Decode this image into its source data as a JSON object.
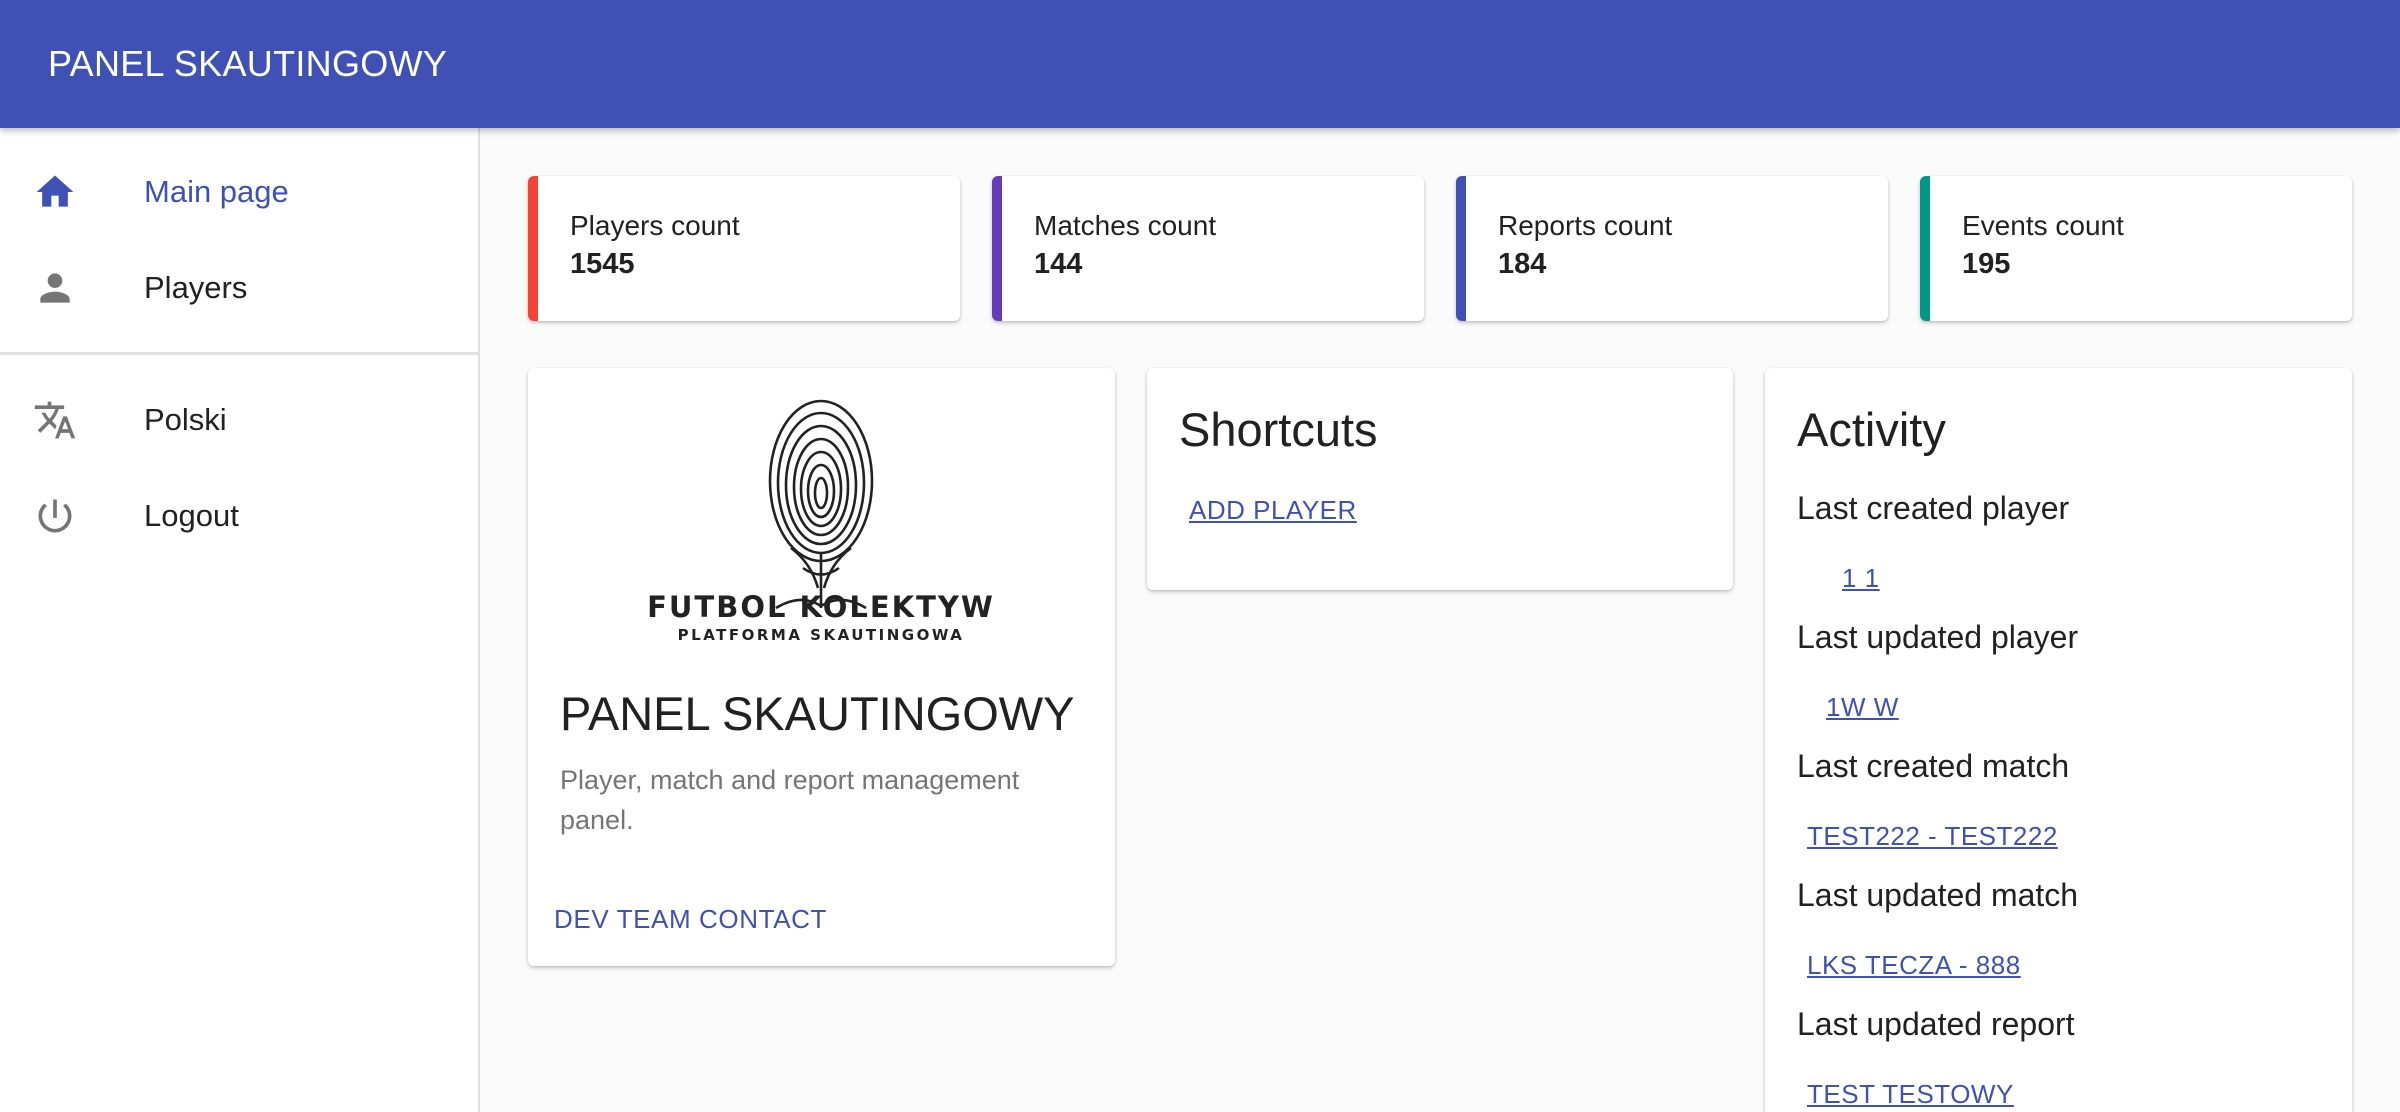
{
  "app": {
    "title": "PANEL SKAUTINGOWY"
  },
  "sidebar": {
    "items": [
      {
        "label": "Main page",
        "icon": "home-icon",
        "active": true
      },
      {
        "label": "Players",
        "icon": "person-icon",
        "active": false
      },
      {
        "label": "Polski",
        "icon": "translate-icon",
        "active": false
      },
      {
        "label": "Logout",
        "icon": "power-icon",
        "active": false
      }
    ]
  },
  "stats": [
    {
      "label": "Players count",
      "value": "1545",
      "color": "#f44336"
    },
    {
      "label": "Matches count",
      "value": "144",
      "color": "#673ab7"
    },
    {
      "label": "Reports count",
      "value": "184",
      "color": "#3f51b5"
    },
    {
      "label": "Events count",
      "value": "195",
      "color": "#009688"
    }
  ],
  "brand_card": {
    "logo_text": "FUTBOL KOLEKTYW",
    "logo_subtext": "PLATFORMA SKAUTINGOWA",
    "title": "PANEL SKAUTINGOWY",
    "description": "Player, match and report management panel.",
    "button": "DEV TEAM CONTACT"
  },
  "shortcuts": {
    "title": "Shortcuts",
    "add_player": "ADD PLAYER"
  },
  "activity": {
    "title": "Activity",
    "items": [
      {
        "label": "Last created player",
        "value": "1 1"
      },
      {
        "label": "Last updated player",
        "value": "1W W"
      },
      {
        "label": "Last created match",
        "value": "TEST222 - TEST222"
      },
      {
        "label": "Last updated match",
        "value": "LKS TECZA - 888"
      },
      {
        "label": "Last updated report",
        "value": "TEST TESTOWY"
      }
    ]
  },
  "colors": {
    "primary": "#3f51b5",
    "icon_gray": "#757575"
  }
}
